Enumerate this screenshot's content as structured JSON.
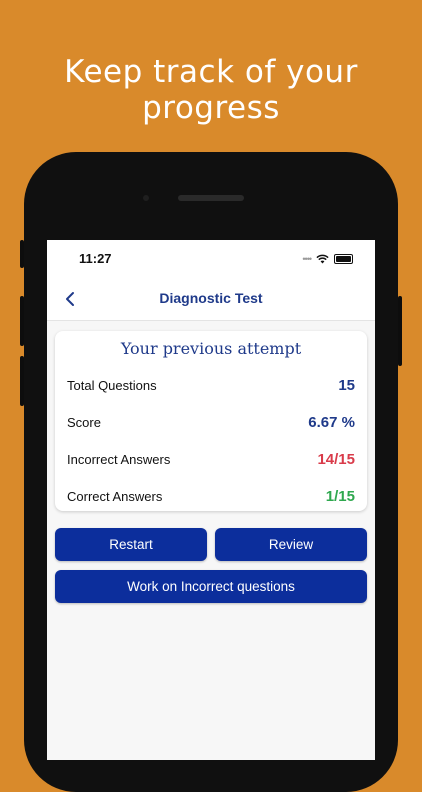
{
  "promo": {
    "headline": "Keep track of your progress"
  },
  "status_bar": {
    "time": "11:27"
  },
  "nav": {
    "title": "Diagnostic Test"
  },
  "attempt_card": {
    "title": "Your previous attempt",
    "rows": [
      {
        "label": "Total Questions",
        "value": "15",
        "color": "#1F3A8A"
      },
      {
        "label": "Score",
        "value": "6.67 %",
        "color": "#1F3A8A"
      },
      {
        "label": "Incorrect Answers",
        "value": "14/15",
        "color": "#D93B4A"
      },
      {
        "label": "Correct Answers",
        "value": "1/15",
        "color": "#2FA84F"
      }
    ]
  },
  "actions": {
    "restart_label": "Restart",
    "review_label": "Review",
    "work_incorrect_label": "Work on Incorrect questions"
  },
  "colors": {
    "background": "#D98A2B",
    "primary": "#0C2E9C",
    "title_blue": "#1F3A8A",
    "incorrect_red": "#D93B4A",
    "correct_green": "#2FA84F"
  }
}
